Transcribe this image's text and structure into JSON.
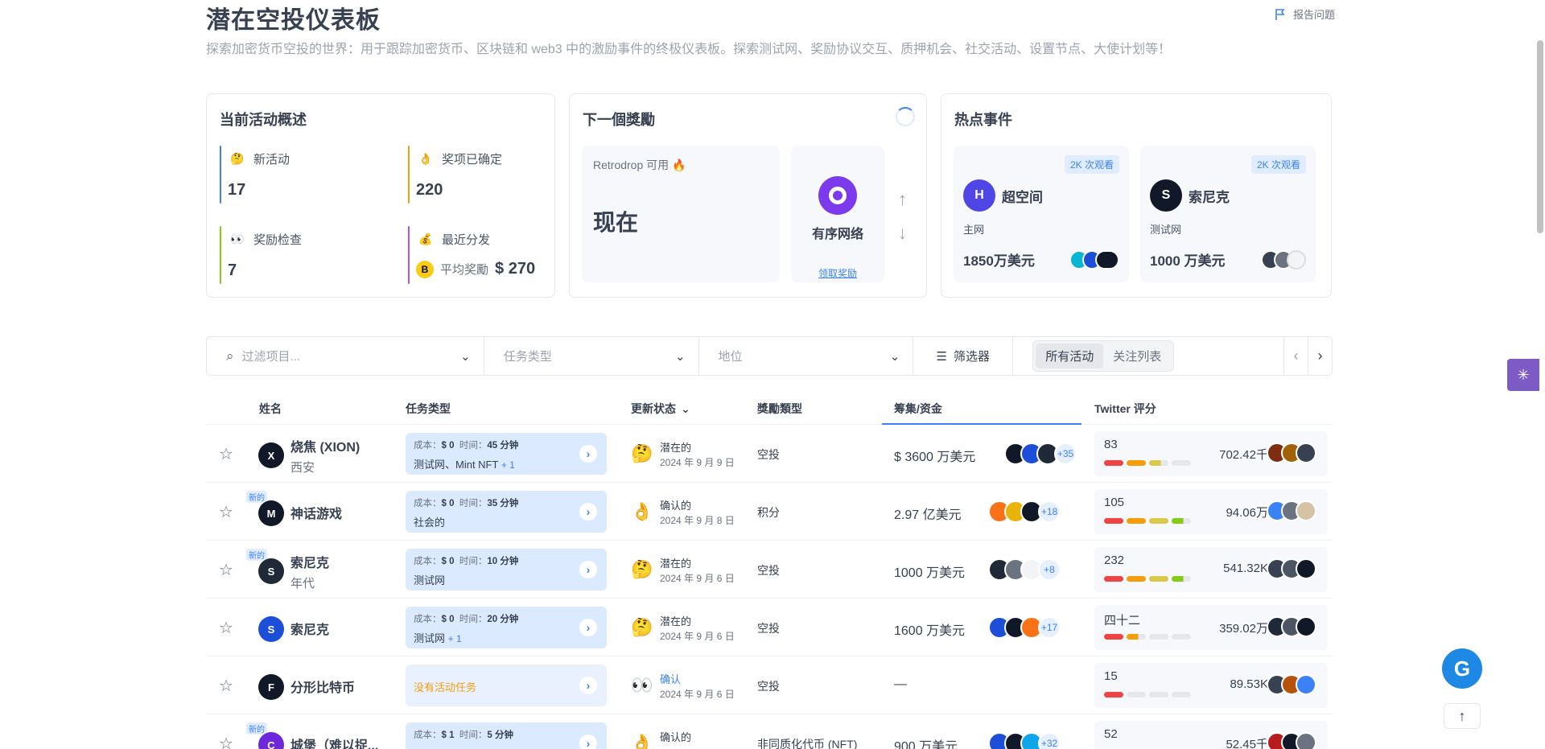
{
  "header": {
    "title": "潜在空投仪表板",
    "subtitle": "探索加密货币空投的世界：用于跟踪加密货币、区块链和 web3 中的激励事件的终极仪表板。探索测试网、奖励协议交互、质押机会、社交活动、设置节点、大使计划等！",
    "report_label": "报告问题"
  },
  "overview": {
    "title": "当前活动概述",
    "items": [
      {
        "label": "新活动",
        "value": "17",
        "emoji": "🤔",
        "color": "#3b82f6"
      },
      {
        "label": "奖项已确定",
        "value": "220",
        "emoji": "👌",
        "color": "#f59e0b"
      },
      {
        "label": "奖励检查",
        "value": "7",
        "emoji": "👀",
        "color": "#84cc16"
      },
      {
        "label": "最近分发",
        "emoji": "💰",
        "color": "#a855f7",
        "avg_label": "平均奖勵",
        "avg_value": "$ 270"
      }
    ]
  },
  "next_reward": {
    "title": "下一個獎勵",
    "retrodrop_label": "Retrodrop 可用 🔥",
    "when": "现在",
    "project_name": "有序网络",
    "claim_link": "领取奖励"
  },
  "hot_events": {
    "title": "热点事件",
    "items": [
      {
        "views": "2K 次观看",
        "name": "超空间",
        "network": "主网",
        "funds": "1850万美元",
        "logo_color": "#4f46e5",
        "logo_letter": "H"
      },
      {
        "views": "2K 次观看",
        "name": "索尼克",
        "network": "测试网",
        "funds": "1000 万美元",
        "logo_color": "#111827",
        "logo_letter": "S"
      }
    ]
  },
  "filters": {
    "search_placeholder": "过滤项目...",
    "task_type": "任务类型",
    "location": "地位",
    "filter_label": "筛选器",
    "tab_all": "所有活动",
    "tab_watch": "关注列表"
  },
  "table": {
    "headers": {
      "name": "姓名",
      "task_type": "任务类型",
      "status": "更新状态",
      "reward_type": "獎勵類型",
      "funds": "筹集/资金",
      "twitter": "Twitter 评分"
    },
    "cost_label": "成本：",
    "time_label": "时间：",
    "rows": [
      {
        "name": "烧焦 (XION)",
        "sub": "西安",
        "is_new": false,
        "cost": "$ 0",
        "time": "45 分钟",
        "types": "测试网、Mint NFT",
        "extra": "+ 1",
        "status": "潜在的",
        "emoji": "🤔",
        "date": "2024 年 9 月 9 日",
        "reward": "空投",
        "funds": "$ 3600 万美元",
        "inv_plus": "+35",
        "score": "83",
        "bars": 3,
        "followers": "702.42千",
        "logo_color": "#111827",
        "logo_letter": "X"
      },
      {
        "name": "神话游戏",
        "sub": "",
        "is_new": true,
        "cost": "$ 0",
        "time": "35 分钟",
        "types": "社会的",
        "extra": "",
        "status": "确认的",
        "emoji": "👌",
        "date": "2024 年 9 月 8 日",
        "reward": "积分",
        "funds": "2.97 亿美元",
        "inv_plus": "+18",
        "score": "105",
        "bars": 4,
        "followers": "94.06万",
        "logo_color": "#111827",
        "logo_letter": "M"
      },
      {
        "name": "索尼克",
        "sub": "年代",
        "is_new": true,
        "cost": "$ 0",
        "time": "10 分钟",
        "types": "测试网",
        "extra": "",
        "status": "潜在的",
        "emoji": "🤔",
        "date": "2024 年 9 月 6 日",
        "reward": "空投",
        "funds": "1000 万美元",
        "inv_plus": "+8",
        "score": "232",
        "bars": 4,
        "followers": "541.32K",
        "logo_color": "#1f2937",
        "logo_letter": "S"
      },
      {
        "name": "索尼克",
        "sub": "",
        "is_new": false,
        "cost": "$ 0",
        "time": "20 分钟",
        "types": "测试网",
        "extra": "+ 1",
        "status": "潜在的",
        "emoji": "🤔",
        "date": "2024 年 9 月 6 日",
        "reward": "空投",
        "funds": "1600 万美元",
        "inv_plus": "+17",
        "score": "四十二",
        "bars": 2,
        "followers": "359.02万",
        "logo_color": "#1d4ed8",
        "logo_letter": "S"
      },
      {
        "name": "分形比特币",
        "sub": "",
        "is_new": false,
        "none_task": "没有活动任务",
        "status": "确认",
        "status_blue": true,
        "emoji": "👀",
        "date": "2024 年 9 月 6 日",
        "reward": "空投",
        "funds": "—",
        "inv_plus": "",
        "score": "15",
        "bars": 1,
        "followers": "89.53K",
        "logo_color": "#111827",
        "logo_letter": "F"
      },
      {
        "name": "城堡（难以捉...",
        "sub": "",
        "is_new": true,
        "cost": "$ 1",
        "time": "5 分钟",
        "types": "",
        "extra": "",
        "status": "确认的",
        "emoji": "👌",
        "date": "",
        "reward": "非同质化代币 (NFT)",
        "funds": "900 万美元",
        "inv_plus": "+32",
        "score": "52",
        "bars": 2,
        "followers": "52.45千",
        "logo_color": "#6d28d9",
        "logo_letter": "C"
      }
    ]
  },
  "colors": {
    "accent": "#3b82f6",
    "bar_red": "#ef4444",
    "bar_orange": "#f59e0b",
    "bar_yellow": "#d9c94a",
    "bar_green": "#84cc16"
  },
  "icons": [
    "flag-icon",
    "search-icon",
    "chevron-down-icon",
    "sliders-icon",
    "star-icon",
    "chevron-right-icon",
    "arrow-up-icon",
    "arrow-down-icon"
  ]
}
